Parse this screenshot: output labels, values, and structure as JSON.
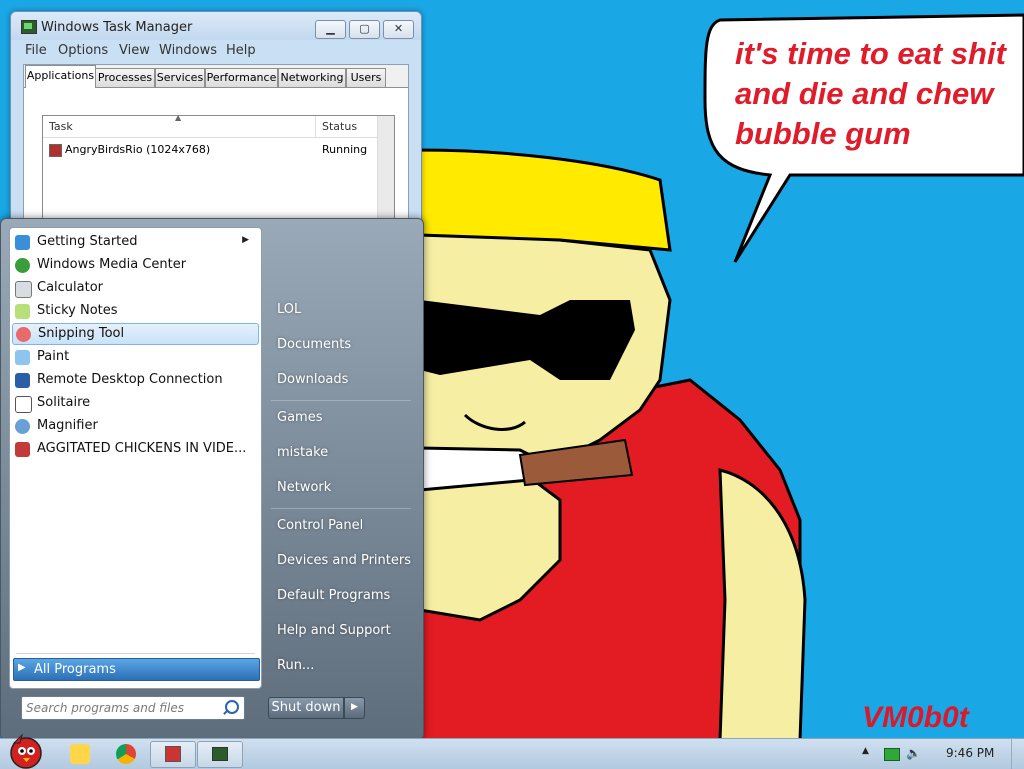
{
  "wallpaper": {
    "speech_lines": [
      "it's time to eat shit",
      "and die and chew",
      "bubble gum"
    ],
    "watermark": "VM0b0t"
  },
  "task_manager": {
    "title": "Windows Task Manager",
    "menu": [
      "File",
      "Options",
      "View",
      "Windows",
      "Help"
    ],
    "tabs": [
      "Applications",
      "Processes",
      "Services",
      "Performance",
      "Networking",
      "Users"
    ],
    "active_tab": "Applications",
    "columns": {
      "task": "Task",
      "status": "Status"
    },
    "rows": [
      {
        "task": "AngryBirdsRio (1024x768)",
        "status": "Running"
      }
    ]
  },
  "start_menu": {
    "programs": [
      {
        "label": "Getting Started",
        "icon": "getting-started-icon",
        "has_submenu": true
      },
      {
        "label": "Windows Media Center",
        "icon": "media-center-icon"
      },
      {
        "label": "Calculator",
        "icon": "calculator-icon"
      },
      {
        "label": "Sticky Notes",
        "icon": "sticky-notes-icon"
      },
      {
        "label": "Snipping Tool",
        "icon": "snipping-tool-icon",
        "selected": true
      },
      {
        "label": "Paint",
        "icon": "paint-icon"
      },
      {
        "label": "Remote Desktop Connection",
        "icon": "remote-desktop-icon"
      },
      {
        "label": "Solitaire",
        "icon": "solitaire-icon"
      },
      {
        "label": "Magnifier",
        "icon": "magnifier-icon"
      },
      {
        "label": "AGGITATED CHICKENS IN VIDE...",
        "icon": "game-icon"
      }
    ],
    "all_programs": "All Programs",
    "search_placeholder": "Search programs and files",
    "places": [
      "LOL",
      "Documents",
      "Downloads",
      "Games",
      "mistake",
      "Network",
      "Control Panel",
      "Devices and Printers",
      "Default Programs",
      "Help and Support",
      "Run..."
    ],
    "shutdown": "Shut down"
  },
  "taskbar": {
    "clock": "9:46 PM"
  }
}
